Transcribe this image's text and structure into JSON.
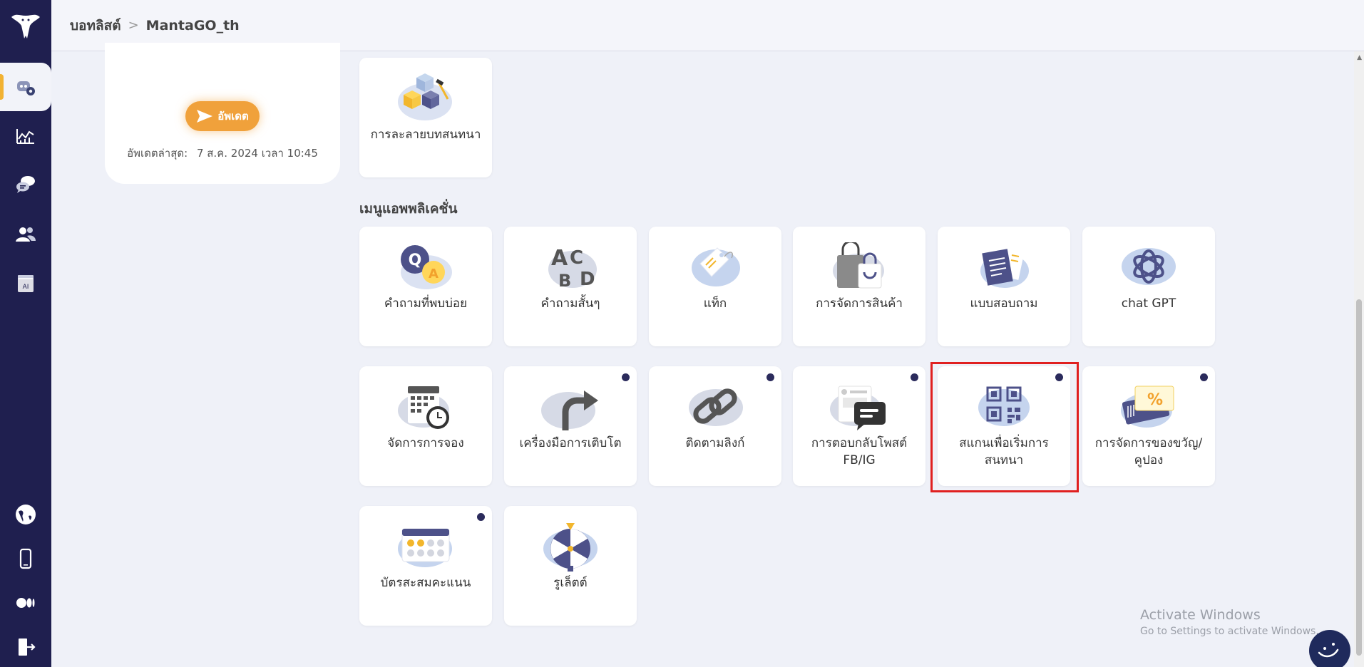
{
  "header": {
    "breadcrumb": [
      "บอทลิสต์",
      "MantaGO_th"
    ],
    "separator": ">"
  },
  "sidebar": {
    "items": [
      {
        "icon": "bot-settings-icon",
        "active": true
      },
      {
        "icon": "analytics-chart-icon",
        "active": false
      },
      {
        "icon": "chat-bubbles-icon",
        "active": false
      },
      {
        "icon": "users-icon",
        "active": false
      },
      {
        "icon": "ai-document-icon",
        "active": false
      },
      {
        "icon": "globe-icon",
        "active": false
      },
      {
        "icon": "mobile-icon",
        "active": false
      },
      {
        "icon": "medium-icon",
        "active": false
      },
      {
        "icon": "logout-icon",
        "active": false
      }
    ]
  },
  "info_card": {
    "update_button": "อัพเดต",
    "last_update_label": "อัพเดตล่าสุด:",
    "last_update_value": "7 ส.ค. 2024 เวลา 10:45"
  },
  "top_tiles": [
    {
      "label": "การละลายบทสนทนา",
      "icon": "cubes-icon"
    }
  ],
  "app_menu": {
    "title": "เมนูแอพพลิเคชั่น",
    "tiles": [
      {
        "label": "คำถามที่พบบ่อย",
        "icon": "faq-qa-icon",
        "dot": false
      },
      {
        "label": "คำถามสั้นๆ",
        "icon": "abcd-letters-icon",
        "dot": false
      },
      {
        "label": "แท็ก",
        "icon": "tag-icon",
        "dot": false
      },
      {
        "label": "การจัดการสินค้า",
        "icon": "shopping-bag-icon",
        "dot": false
      },
      {
        "label": "แบบสอบถาม",
        "icon": "survey-notes-icon",
        "dot": false
      },
      {
        "label": "chat GPT",
        "icon": "chatgpt-icon",
        "dot": false
      },
      {
        "label": "จัดการการจอง",
        "icon": "calendar-clock-icon",
        "dot": false
      },
      {
        "label": "เครื่องมือการเติบโต",
        "icon": "growth-arrow-icon",
        "dot": true
      },
      {
        "label": "ติดตามลิงก์",
        "icon": "link-icon",
        "dot": true
      },
      {
        "label": "การตอบกลับโพสต์ FB/IG",
        "icon": "post-reply-icon",
        "dot": true
      },
      {
        "label": "สแกนเพื่อเริ่มการสนทนา",
        "icon": "qr-code-icon",
        "dot": true
      },
      {
        "label": "การจัดการของขวัญ/คูปอง",
        "icon": "coupon-icon",
        "dot": true
      },
      {
        "label": "บัตรสะสมคะแนน",
        "icon": "loyalty-card-icon",
        "dot": true
      },
      {
        "label": "รูเล็ตต์",
        "icon": "roulette-wheel-icon",
        "dot": false
      }
    ]
  },
  "watermark": {
    "line1": "Activate Windows",
    "line2": "Go to Settings to activate Windows."
  },
  "colors": {
    "sidebar": "#1f1f4f",
    "accent": "#f0a13b",
    "highlight": "#e02020",
    "dot": "#2b2b5c"
  }
}
